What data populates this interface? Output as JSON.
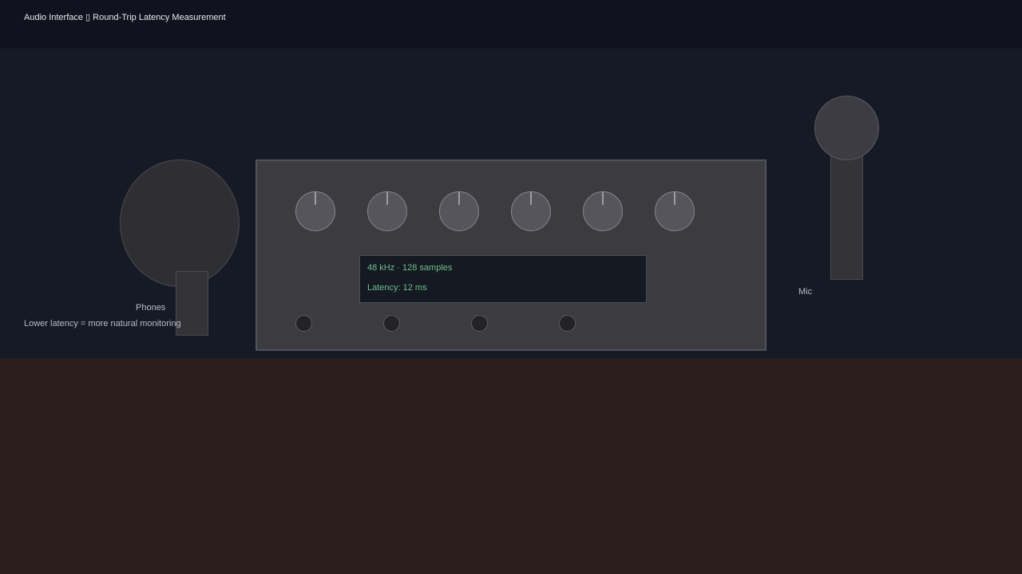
{
  "header": {
    "title": "Audio Interface ▯ Round-Trip Latency Measurement"
  },
  "devices": {
    "phones_label": "Phones",
    "mic_label": "Mic",
    "note": "Lower latency = more natural monitoring"
  },
  "interface": {
    "display": {
      "line1": "48 kHz · 128 samples",
      "line2": "Latency: 12 ms"
    },
    "knob_count": 6,
    "jack_count": 4
  },
  "colors": {
    "background_wall": "#161a25",
    "desk": "#2a1f1b",
    "display_text": "#6fbf8a"
  }
}
